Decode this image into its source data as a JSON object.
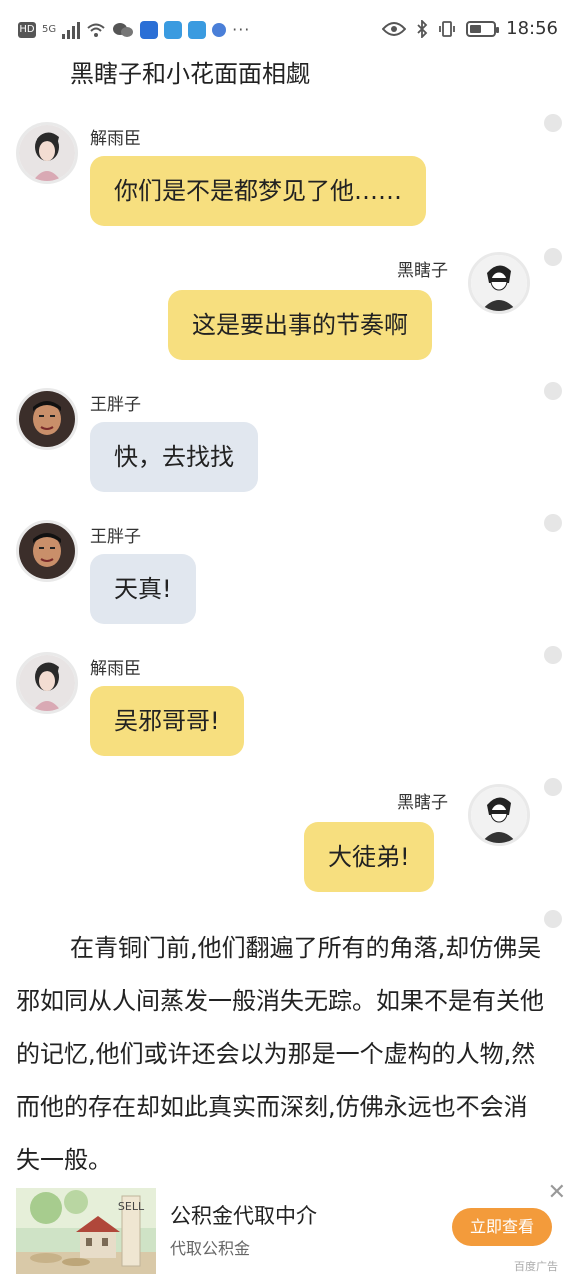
{
  "status_bar": {
    "hd_label": "HD",
    "network_label": "5G",
    "more_label": "···",
    "time": "18:56",
    "battery_level_percent": 50
  },
  "page": {
    "title": "黑瞎子和小花面面相觑"
  },
  "messages": [
    {
      "sender": "解雨臣",
      "text": "你们是不是都梦见了他……",
      "side": "left",
      "bubble": "yellow",
      "avatar": "xie-yuchen-avatar"
    },
    {
      "sender": "黑瞎子",
      "text": "这是要出事的节奏啊",
      "side": "right",
      "bubble": "yellow",
      "avatar": "hei-xiazi-avatar"
    },
    {
      "sender": "王胖子",
      "text": "快，去找找",
      "side": "left",
      "bubble": "grey",
      "avatar": "wang-pangzi-avatar"
    },
    {
      "sender": "王胖子",
      "text": "天真!",
      "side": "left",
      "bubble": "grey",
      "avatar": "wang-pangzi-avatar"
    },
    {
      "sender": "解雨臣",
      "text": "吴邪哥哥!",
      "side": "left",
      "bubble": "yellow",
      "avatar": "xie-yuchen-avatar"
    },
    {
      "sender": "黑瞎子",
      "text": "大徒弟!",
      "side": "right",
      "bubble": "yellow",
      "avatar": "hei-xiazi-avatar"
    }
  ],
  "narration": "在青铜门前,他们翻遍了所有的角落,却仿佛吴邪如同从人间蒸发一般消失无踪。如果不是有关他的记忆,他们或许还会以为那是一个虚构的人物,然而他的存在却如此真实而深刻,仿佛永远也不会消失一般。",
  "ad": {
    "title": "公积金代取中介",
    "subtitle": "代取公积金",
    "cta": "立即查看",
    "close": "✕",
    "label": "百度广告",
    "image_sign_text": "SELL"
  },
  "colors": {
    "yellow_bubble": "#f7df7f",
    "grey_bubble": "#e1e7ef",
    "cta": "#f39b3b"
  }
}
